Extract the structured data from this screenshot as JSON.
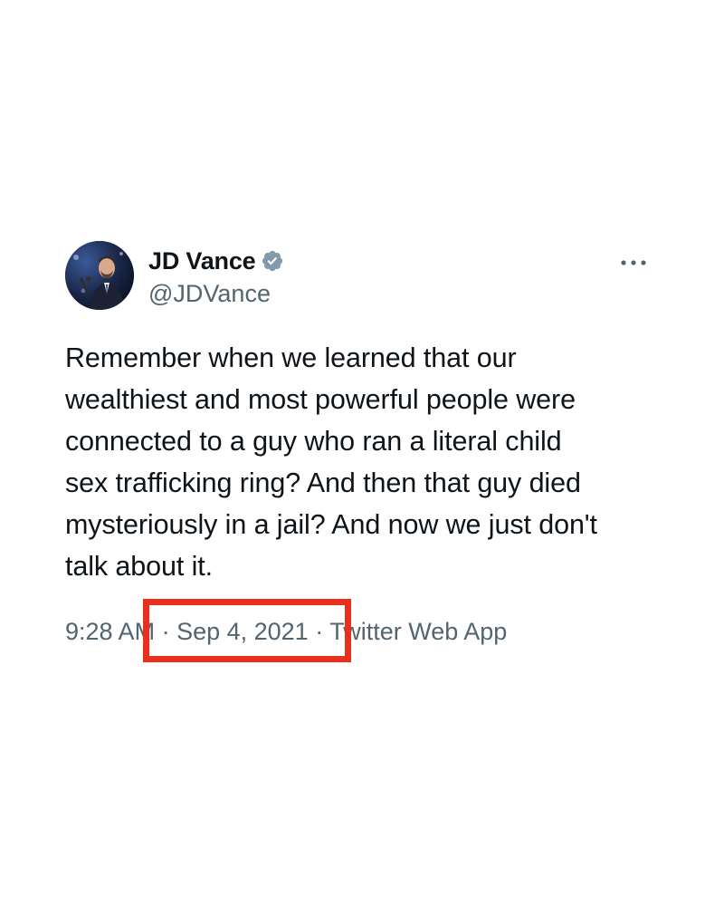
{
  "tweet": {
    "author": {
      "display_name": "JD Vance",
      "handle": "@JDVance",
      "verified": true
    },
    "text": "Remember when we learned that our\nwealthiest and most powerful people were\nconnected to a guy who ran a literal child\nsex trafficking ring? And then that guy died\nmysteriously in a jail? And now we just don't\ntalk about it.",
    "meta": {
      "time": "9:28 AM",
      "separator": " · ",
      "date": "Sep 4, 2021",
      "source": "Twitter Web App"
    }
  },
  "colors": {
    "verified_badge": "#829aab",
    "highlight_box": "#e8301c",
    "secondary_text": "#536471"
  },
  "icons": {
    "verified": "verified-badge-icon",
    "more": "more-options-icon"
  }
}
